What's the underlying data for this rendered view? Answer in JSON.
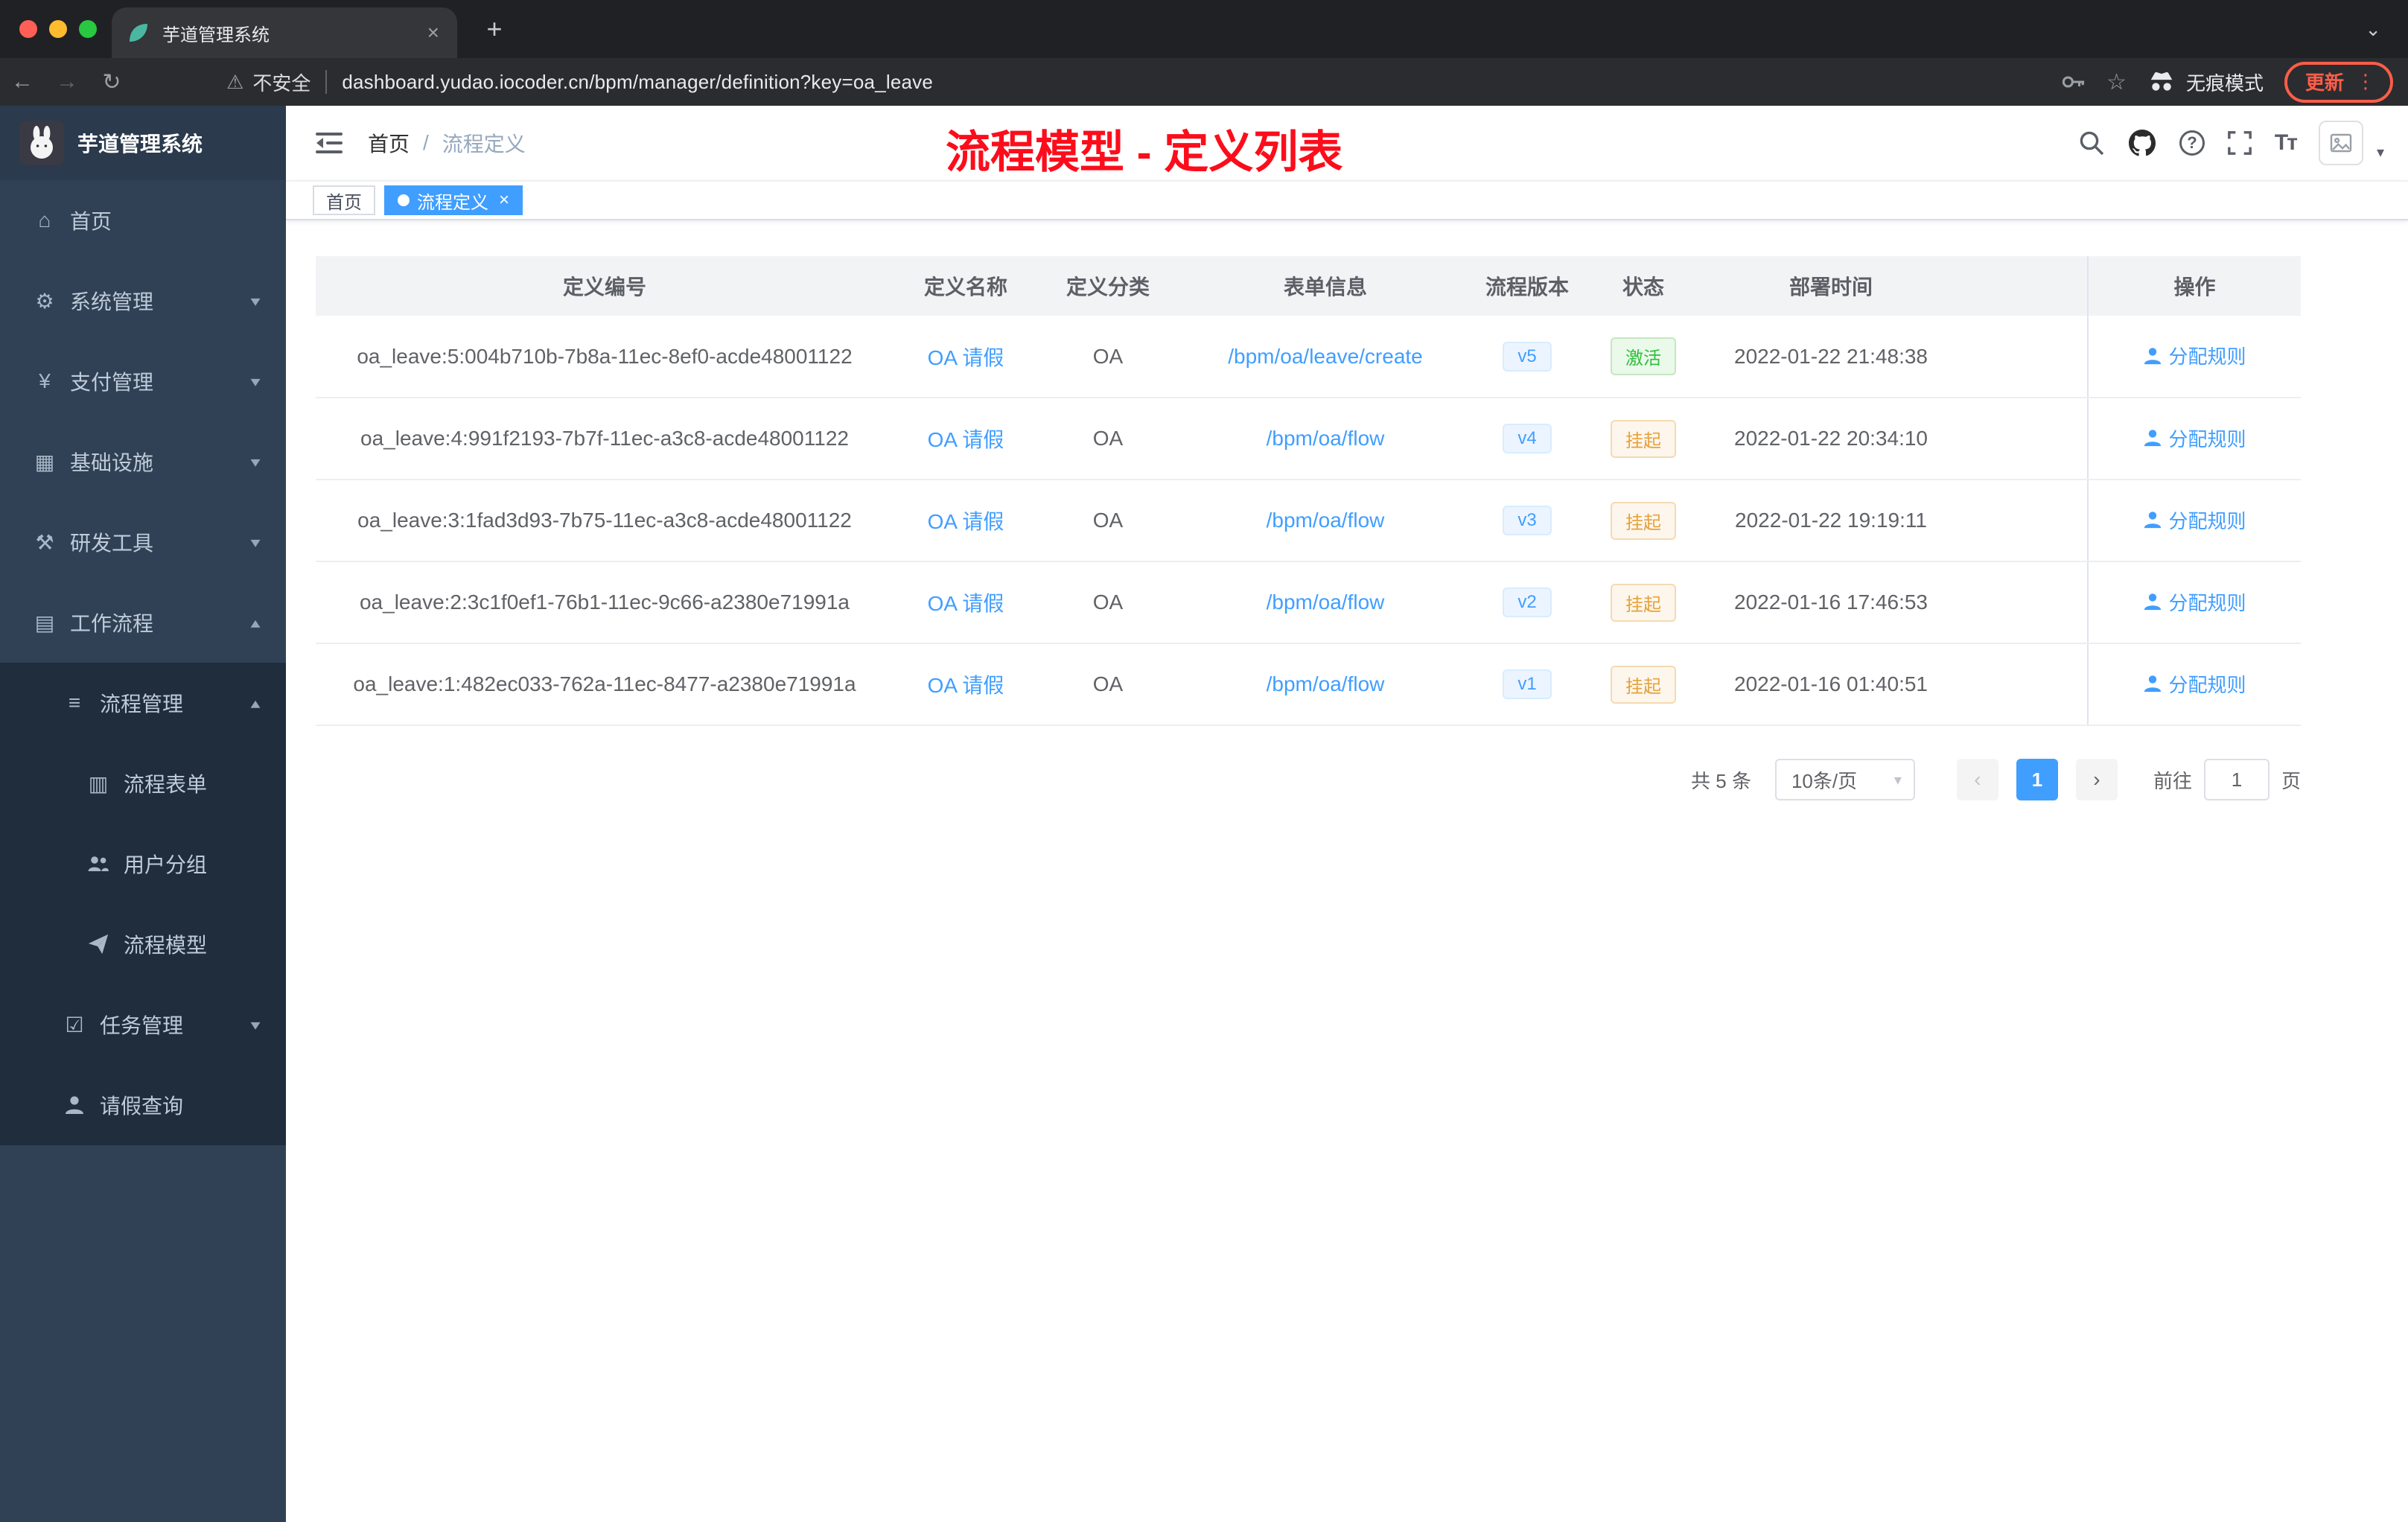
{
  "browser": {
    "tab_title": "芋道管理系统",
    "security_label": "不安全",
    "url": "dashboard.yudao.iocoder.cn/bpm/manager/definition?key=oa_leave",
    "incognito_label": "无痕模式",
    "update_label": "更新"
  },
  "icons": {
    "close": "×",
    "plus": "+",
    "kebab": "⋮",
    "chevron_down": "⌄",
    "back": "←",
    "forward": "→",
    "reload": "↻",
    "warning": "⚠",
    "star": "☆",
    "caret_down": "▾",
    "caret_up": "▴",
    "arrow_left": "‹",
    "arrow_right": "›"
  },
  "sidebar": {
    "logo_title": "芋道管理系统",
    "menu": [
      {
        "label": "首页",
        "icon": "home-icon",
        "glyph": "⌂"
      },
      {
        "label": "系统管理",
        "icon": "gear-icon",
        "glyph": "⚙"
      },
      {
        "label": "支付管理",
        "icon": "yen-icon",
        "glyph": "¥"
      },
      {
        "label": "基础设施",
        "icon": "infrastructure-icon",
        "glyph": "▦"
      },
      {
        "label": "研发工具",
        "icon": "devtools-icon",
        "glyph": "⚒"
      },
      {
        "label": "工作流程",
        "icon": "workflow-icon",
        "glyph": "▤"
      },
      {
        "label": "流程管理",
        "icon": "process-management-icon",
        "glyph": "≡"
      },
      {
        "label": "流程表单",
        "icon": "process-form-icon",
        "glyph": "▥"
      },
      {
        "label": "用户分组",
        "icon": "user-group-icon",
        "glyph": ""
      },
      {
        "label": "流程模型",
        "icon": "process-model-icon",
        "glyph": ""
      },
      {
        "label": "任务管理",
        "icon": "task-management-icon",
        "glyph": "☑"
      },
      {
        "label": "请假查询",
        "icon": "leave-query-icon",
        "glyph": ""
      }
    ]
  },
  "navbar": {
    "breadcrumb_home": "首页",
    "breadcrumb_sep": "/",
    "breadcrumb_current": "流程定义",
    "annotation": "流程模型 - 定义列表",
    "help_glyph": "?",
    "font_size_glyph": "Tт"
  },
  "tags": {
    "home": "首页",
    "active": "流程定义"
  },
  "table": {
    "headers": [
      "定义编号",
      "定义名称",
      "定义分类",
      "表单信息",
      "流程版本",
      "状态",
      "部署时间",
      "操作"
    ],
    "rows": [
      {
        "id": "oa_leave:5:004b710b-7b8a-11ec-8ef0-acde48001122",
        "name": "OA 请假",
        "category": "OA",
        "form": "/bpm/oa/leave/create",
        "version": "v5",
        "status": "激活",
        "status_type": "success",
        "time": "2022-01-22 21:48:38",
        "action": "分配规则"
      },
      {
        "id": "oa_leave:4:991f2193-7b7f-11ec-a3c8-acde48001122",
        "name": "OA 请假",
        "category": "OA",
        "form": "/bpm/oa/flow",
        "version": "v4",
        "status": "挂起",
        "status_type": "warning",
        "time": "2022-01-22 20:34:10",
        "action": "分配规则"
      },
      {
        "id": "oa_leave:3:1fad3d93-7b75-11ec-a3c8-acde48001122",
        "name": "OA 请假",
        "category": "OA",
        "form": "/bpm/oa/flow",
        "version": "v3",
        "status": "挂起",
        "status_type": "warning",
        "time": "2022-01-22 19:19:11",
        "action": "分配规则"
      },
      {
        "id": "oa_leave:2:3c1f0ef1-76b1-11ec-9c66-a2380e71991a",
        "name": "OA 请假",
        "category": "OA",
        "form": "/bpm/oa/flow",
        "version": "v2",
        "status": "挂起",
        "status_type": "warning",
        "time": "2022-01-16 17:46:53",
        "action": "分配规则"
      },
      {
        "id": "oa_leave:1:482ec033-762a-11ec-8477-a2380e71991a",
        "name": "OA 请假",
        "category": "OA",
        "form": "/bpm/oa/flow",
        "version": "v1",
        "status": "挂起",
        "status_type": "warning",
        "time": "2022-01-16 01:40:51",
        "action": "分配规则"
      }
    ]
  },
  "pagination": {
    "total": "共 5 条",
    "page_size": "10条/页",
    "page": "1",
    "jump_prefix": "前往",
    "jump_value": "1",
    "jump_suffix": "页"
  },
  "colors": {
    "accent": "#409eff",
    "success": "#2fbf3e",
    "warning": "#e6a23c",
    "annotation": "#fc0d1b",
    "sidebar_bg": "#304156",
    "sidebar_sub_bg": "#1f2d3d"
  }
}
